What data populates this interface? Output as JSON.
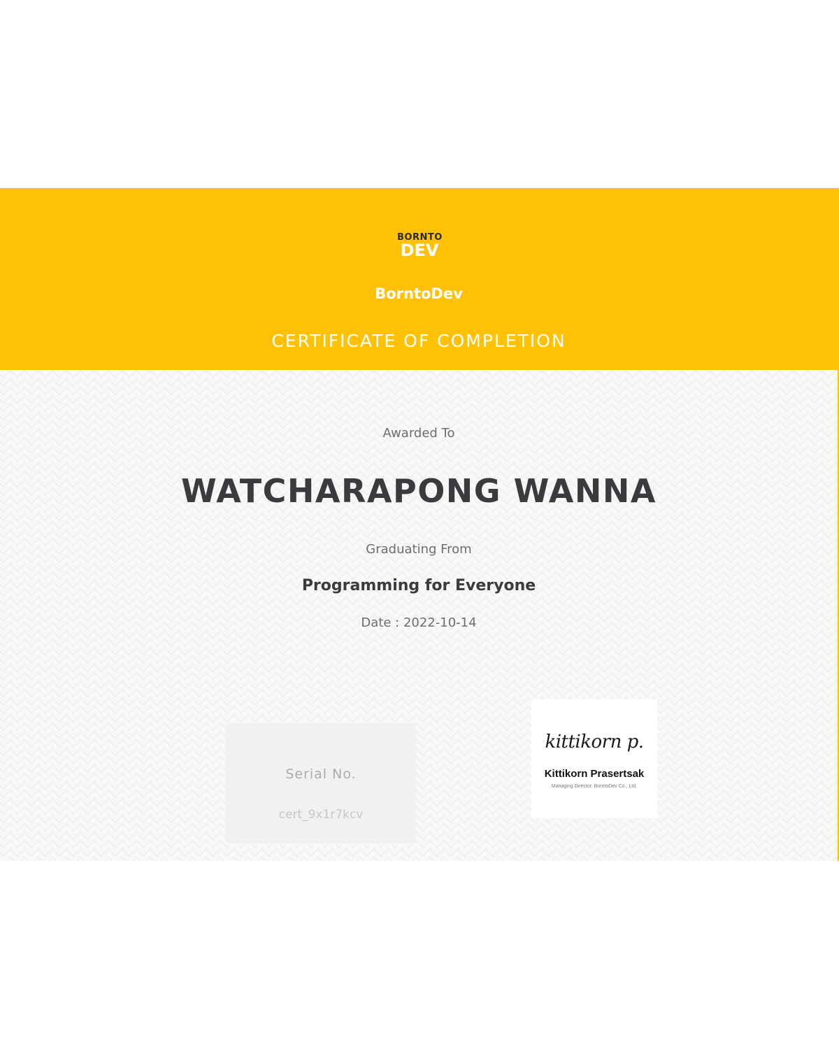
{
  "header": {
    "logo_line1": "BORNTO",
    "logo_line2": "DEV",
    "org_name": "BorntoDev",
    "title": "CERTIFICATE OF COMPLETION"
  },
  "body": {
    "awarded_label": "Awarded To",
    "recipient": "WATCHARAPONG WANNA",
    "graduating_label": "Graduating From",
    "course": "Programming for Everyone",
    "date": "Date : 2022-10-14"
  },
  "serial": {
    "label": "Serial No.",
    "value": "cert_9x1r7kcv"
  },
  "signature": {
    "script": "kittikorn p.",
    "name": "Kittikorn Prasertsak",
    "role": "Managing Director, BorntoDev Co., Ltd."
  },
  "colors": {
    "accent": "#fec105",
    "text_dark": "#3a3b3e",
    "text_muted": "#6b6e72"
  }
}
